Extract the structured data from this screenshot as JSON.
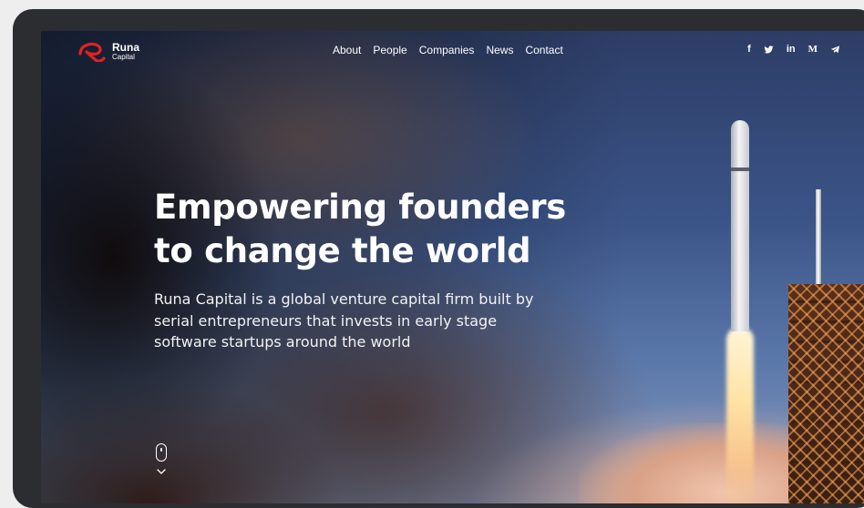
{
  "brand": {
    "name_line1": "Runa",
    "name_line2": "Capital",
    "accent_color": "#e02222"
  },
  "nav": {
    "items": [
      {
        "label": "About"
      },
      {
        "label": "People"
      },
      {
        "label": "Companies"
      },
      {
        "label": "News"
      },
      {
        "label": "Contact"
      }
    ]
  },
  "social": [
    {
      "icon": "facebook-icon",
      "glyph": "f"
    },
    {
      "icon": "twitter-icon",
      "glyph": ""
    },
    {
      "icon": "linkedin-icon",
      "glyph": "in"
    },
    {
      "icon": "medium-icon",
      "glyph": "M"
    },
    {
      "icon": "telegram-icon",
      "glyph": ""
    }
  ],
  "hero": {
    "title_line1": "Empowering founders",
    "title_line2": "to change the world",
    "subtitle": "Runa Capital is a global venture capital firm built by serial entrepreneurs that invests in early stage software startups around the world"
  },
  "scroll": {
    "icon": "mouse-scroll-icon",
    "chevron": "chevron-down-icon"
  }
}
